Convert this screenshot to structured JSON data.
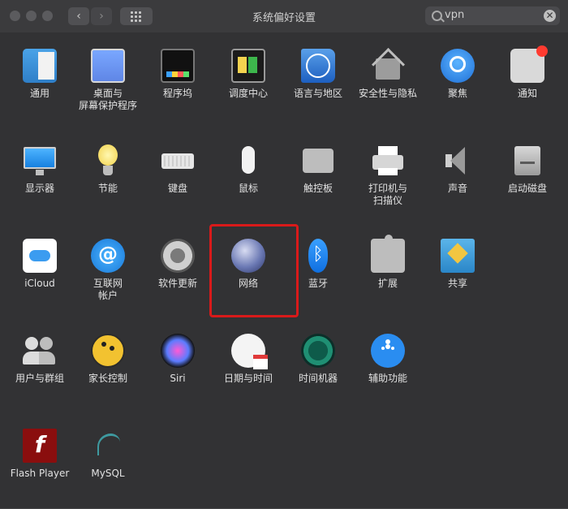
{
  "window": {
    "title": "系统偏好设置"
  },
  "toolbar": {
    "back_label": "‹",
    "forward_label": "›",
    "search": {
      "value": "vpn",
      "clear_label": "✕"
    }
  },
  "sections": [
    {
      "items": [
        {
          "label": "通用",
          "icon": "general-icon"
        },
        {
          "label": "桌面与\n屏幕保护程序",
          "icon": "desktop-screensaver-icon"
        },
        {
          "label": "程序坞",
          "icon": "dock-icon"
        },
        {
          "label": "调度中心",
          "icon": "mission-control-icon"
        },
        {
          "label": "语言与地区",
          "icon": "language-region-icon"
        },
        {
          "label": "安全性与隐私",
          "icon": "security-privacy-icon"
        },
        {
          "label": "聚焦",
          "icon": "spotlight-icon"
        },
        {
          "label": "通知",
          "icon": "notifications-icon"
        }
      ]
    },
    {
      "items": [
        {
          "label": "显示器",
          "icon": "displays-icon"
        },
        {
          "label": "节能",
          "icon": "energy-saver-icon"
        },
        {
          "label": "键盘",
          "icon": "keyboard-icon"
        },
        {
          "label": "鼠标",
          "icon": "mouse-icon"
        },
        {
          "label": "触控板",
          "icon": "trackpad-icon"
        },
        {
          "label": "打印机与\n扫描仪",
          "icon": "printers-scanners-icon"
        },
        {
          "label": "声音",
          "icon": "sound-icon"
        },
        {
          "label": "启动磁盘",
          "icon": "startup-disk-icon"
        }
      ]
    },
    {
      "items": [
        {
          "label": "iCloud",
          "icon": "icloud-icon"
        },
        {
          "label": "互联网\n帐户",
          "icon": "internet-accounts-icon"
        },
        {
          "label": "软件更新",
          "icon": "software-update-icon"
        },
        {
          "label": "网络",
          "icon": "network-icon"
        },
        {
          "label": "蓝牙",
          "icon": "bluetooth-icon"
        },
        {
          "label": "扩展",
          "icon": "extensions-icon"
        },
        {
          "label": "共享",
          "icon": "sharing-icon"
        }
      ]
    },
    {
      "items": [
        {
          "label": "用户与群组",
          "icon": "users-groups-icon"
        },
        {
          "label": "家长控制",
          "icon": "parental-controls-icon"
        },
        {
          "label": "Siri",
          "icon": "siri-icon"
        },
        {
          "label": "日期与时间",
          "icon": "date-time-icon"
        },
        {
          "label": "时间机器",
          "icon": "time-machine-icon"
        },
        {
          "label": "辅助功能",
          "icon": "accessibility-icon"
        }
      ]
    },
    {
      "items": [
        {
          "label": "Flash Player",
          "icon": "flash-player-icon"
        },
        {
          "label": "MySQL",
          "icon": "mysql-icon"
        }
      ]
    }
  ],
  "highlight": {
    "target": "网络",
    "color": "#d91a1a"
  }
}
